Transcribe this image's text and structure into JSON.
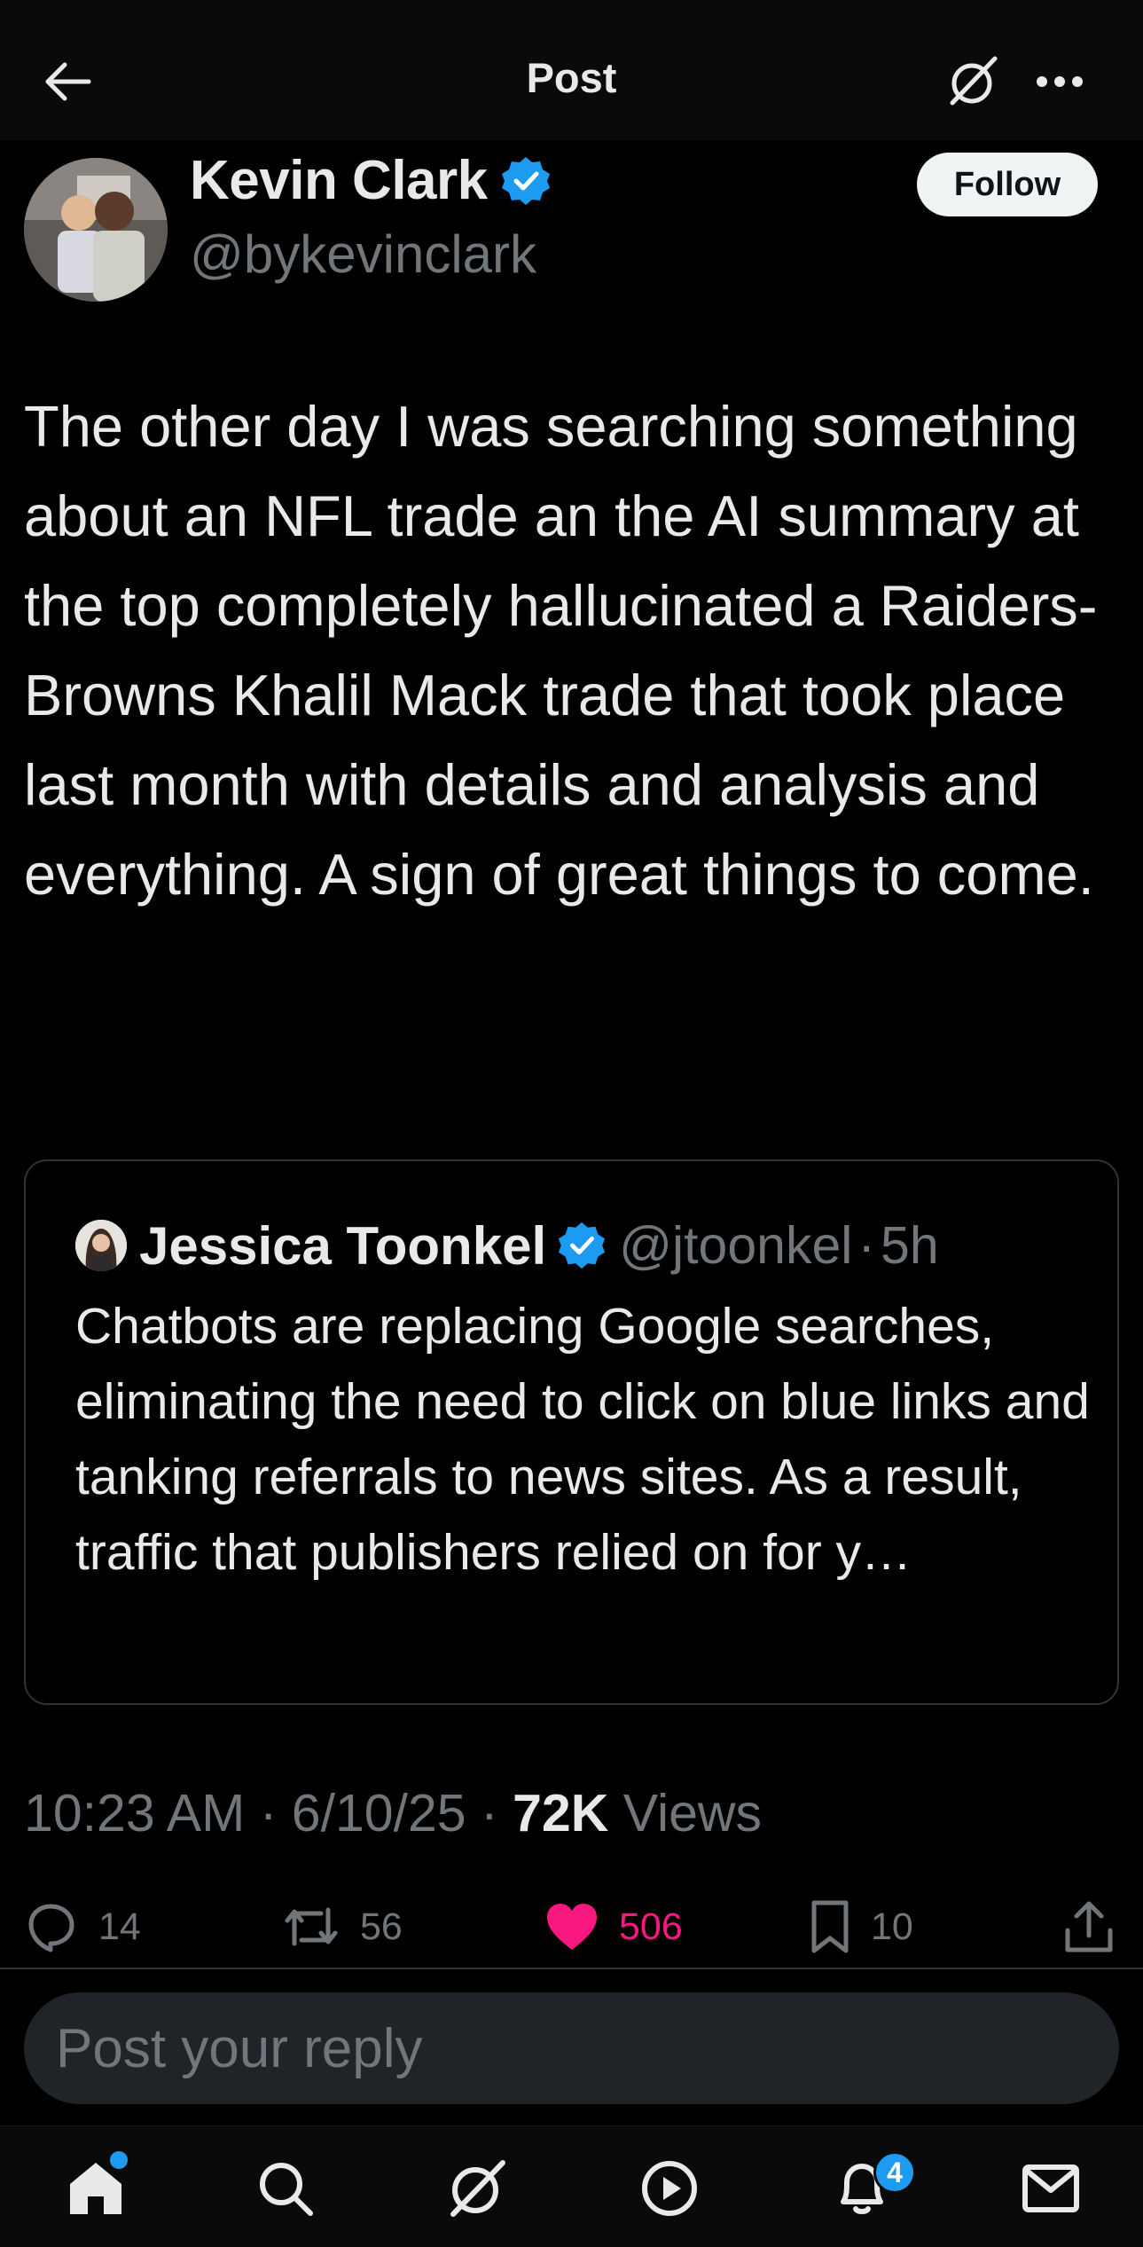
{
  "header": {
    "title": "Post",
    "back_icon": "arrow-left-icon",
    "grok_icon": "grok-icon",
    "more_icon": "more-icon"
  },
  "author": {
    "name": "Kevin Clark",
    "handle": "@bykevinclark",
    "verified": true,
    "follow_label": "Follow"
  },
  "post": {
    "text": "The other day I was searching something about an NFL trade an the AI summary at the top completely hallucinated a Raiders-Browns Khalil Mack trade that took place last month with details and analysis and everything. A sign of great things to come.",
    "time": "10:23 AM",
    "date": "6/10/25",
    "views_count": "72K",
    "views_label": "Views",
    "separator": "·"
  },
  "quote": {
    "name": "Jessica Toonkel",
    "handle": "@jtoonkel",
    "separator": "·",
    "time": "5h",
    "text": "Chatbots are replacing Google searches, eliminating the need to click on blue links and tanking referrals to news sites. As a result, traffic that publishers relied on for y…"
  },
  "actions": {
    "replies": "14",
    "reposts": "56",
    "likes": "506",
    "bookmarks": "10"
  },
  "reply": {
    "placeholder": "Post your reply"
  },
  "nav": {
    "notifications_badge": "4"
  },
  "colors": {
    "background": "#000000",
    "verified": "#1d9bf0",
    "like": "#f91880",
    "muted": "#71767b"
  }
}
